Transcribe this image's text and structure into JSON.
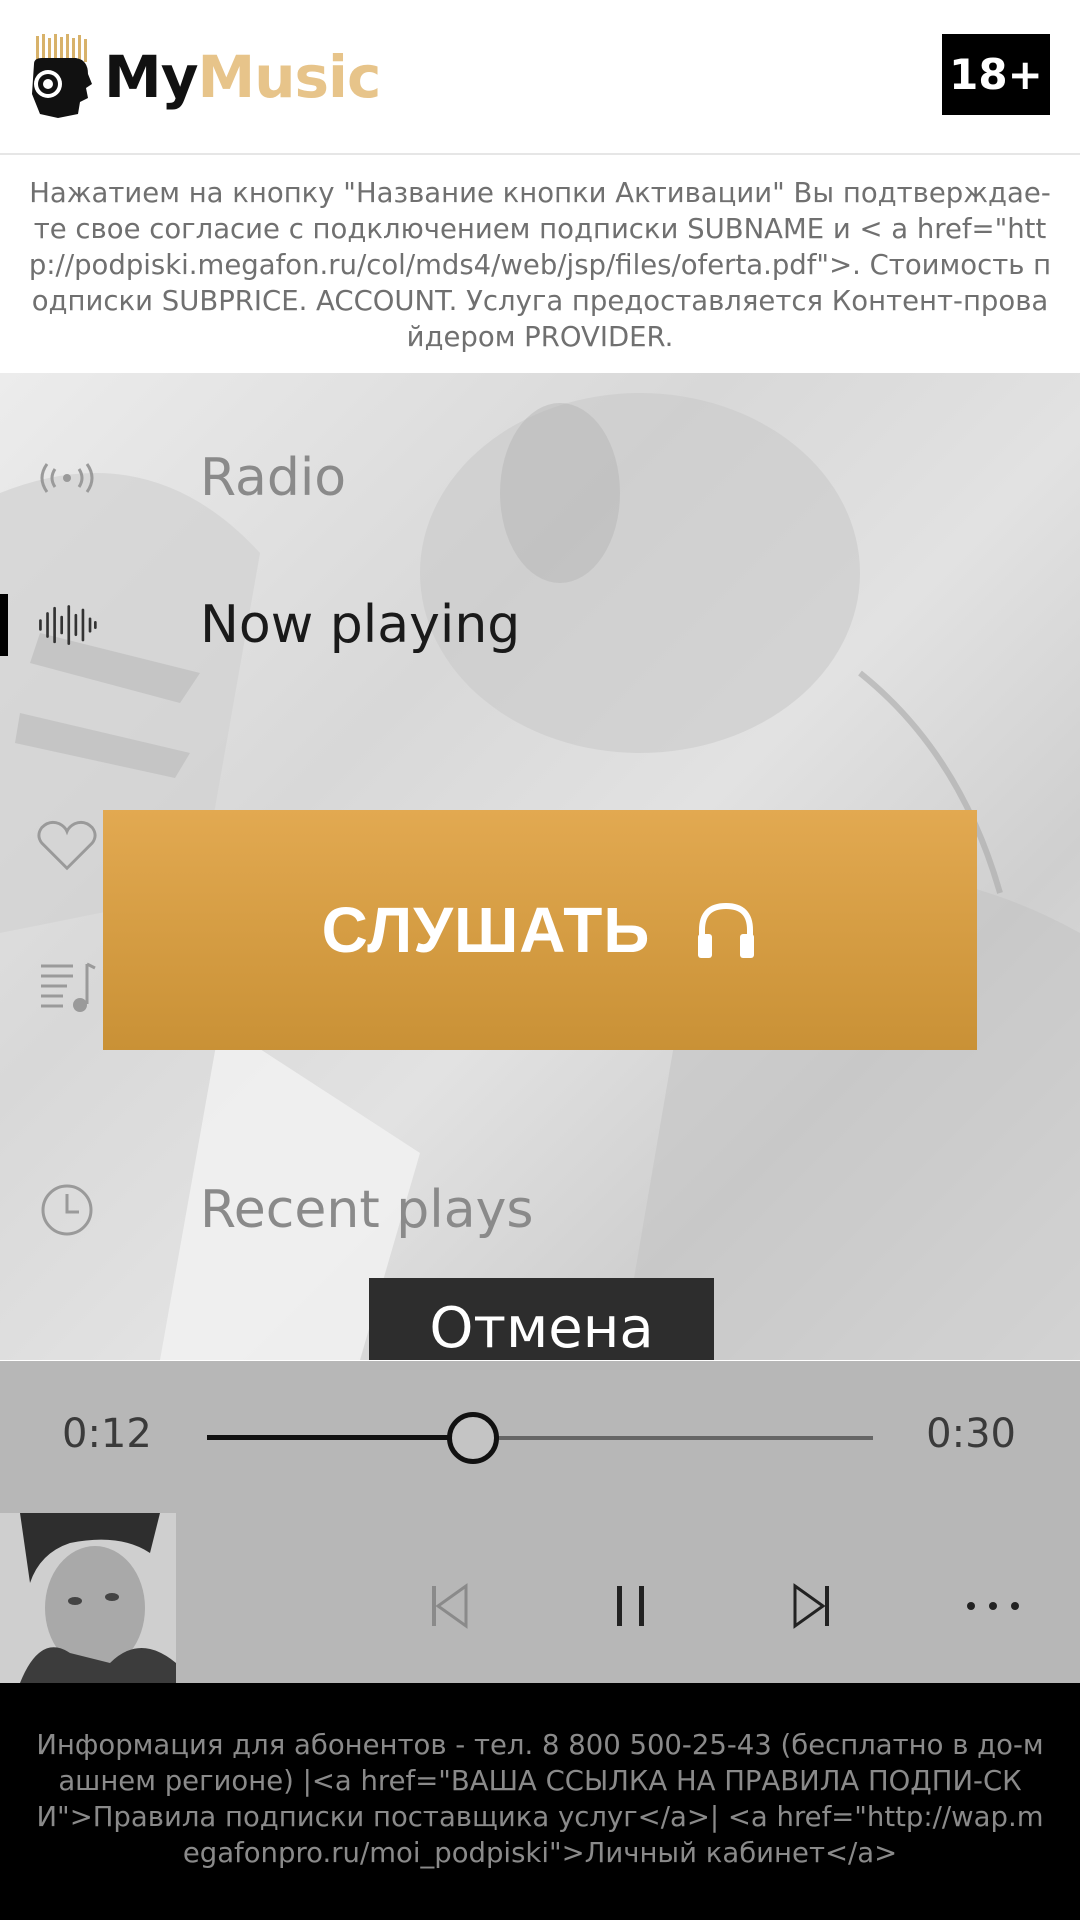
{
  "header": {
    "logo_my": "My",
    "logo_music": "Music",
    "age_rating": "18+"
  },
  "disclaimer": {
    "text": "Нажатием на кнопку \"Название кнопки Активации\" Вы подтверждае-те свое согласие с подключением подписки SUBNAME и < a href=\"http://podpiski.megafon.ru/col/mds4/web/jsp/files/oferta.pdf\">. Стоимость подписки SUBPRICE. ACCOUNT. Услуга предоставляется Контент-провайдером PROVIDER."
  },
  "nav": {
    "items": [
      {
        "label": "Radio",
        "icon": "radio-icon"
      },
      {
        "label": "Now playing",
        "icon": "waveform-icon",
        "active": true
      },
      {
        "label": "",
        "icon": "heart-icon"
      },
      {
        "label": "",
        "icon": "playlist-icon"
      },
      {
        "label": "Recent plays",
        "icon": "clock-icon"
      }
    ]
  },
  "cta": {
    "listen_label": "СЛУШАТЬ",
    "cancel_label": "Отмена"
  },
  "player": {
    "current_time": "0:12",
    "total_time": "0:30",
    "progress": 0.4,
    "controls": [
      "previous-icon",
      "pause-icon",
      "next-icon",
      "more-icon"
    ]
  },
  "footer": {
    "text": "Информация для абонентов - тел. 8 800 500-25-43 (бесплатно в до-машнем регионе) |<a href=\"ВАША ССЫЛКА НА ПРАВИЛА ПОДПИ-СКИ\">Правила подписки поставщика услуг</a>| <a href=\"http://wap.megafonpro.ru/moi_podpiski\">Личный кабинет</a>"
  }
}
